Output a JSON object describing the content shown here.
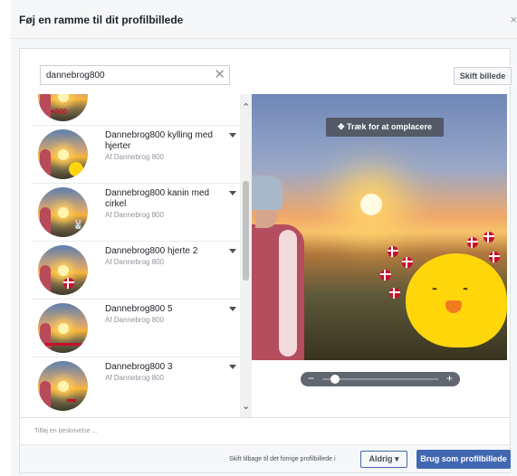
{
  "dialog": {
    "title": "Føj en ramme til dit profilbillede",
    "close_glyph": "×"
  },
  "search": {
    "value": "dannebrog800",
    "clear_glyph": "✕"
  },
  "swap_image_label": "Skift billede",
  "frames": [
    {
      "title": "",
      "author": ""
    },
    {
      "title": "Dannebrog800 kylling med hjerter",
      "author": "Af Dannebrog 800"
    },
    {
      "title": "Dannebrog800 kanin med cirkel",
      "author": "Af Dannebrog 800"
    },
    {
      "title": "Dannebrog800 hjerte 2",
      "author": "Af Dannebrog 800"
    },
    {
      "title": "Dannebrog800 5",
      "author": "Af Dannebrog 800"
    },
    {
      "title": "Dannebrog800 3",
      "author": "Af Dannebrog 800"
    }
  ],
  "preview": {
    "drag_label": "✥ Træk for at omplacere",
    "zoom_minus": "−",
    "zoom_plus": "+",
    "zoom_level": 0.08
  },
  "description_placeholder": "Tilføj en beskrivelse ...",
  "footer": {
    "revert_text": "Skift tilbage til det forrige profilbillede i",
    "never_label": "Aldrig ▾",
    "use_label": "Brug som profilbillede"
  },
  "icons": {
    "scroll_up": "⌃",
    "scroll_down": "⌄"
  },
  "colors": {
    "primary_blue": "#4267b2",
    "danish_red": "#c8102e",
    "chick_yellow": "#ffd60a"
  }
}
